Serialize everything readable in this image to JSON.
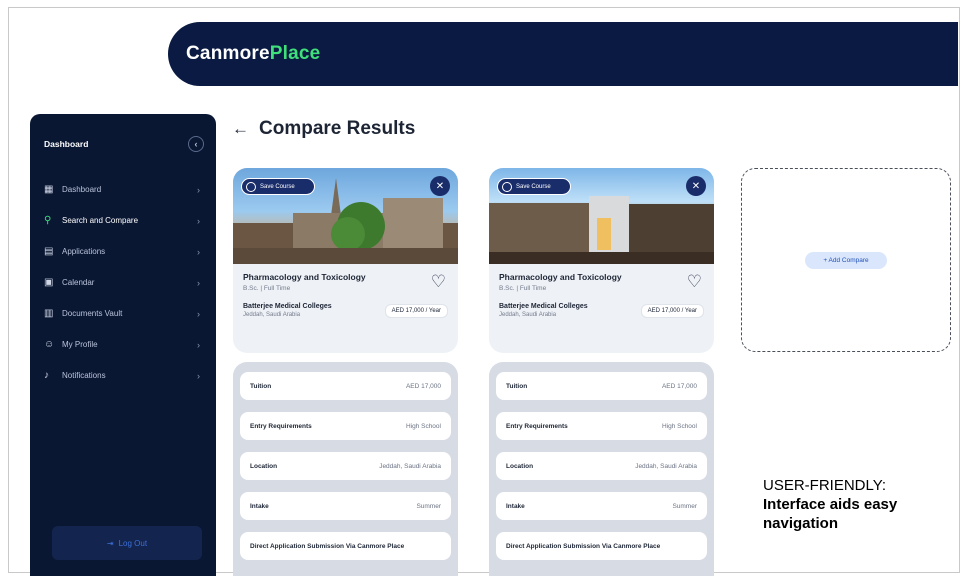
{
  "brand": {
    "logo_part1": "Canmore",
    "logo_part2": "Place"
  },
  "sidebar": {
    "title": "Dashboard",
    "collapse_icon": "chevron-left-icon",
    "items": [
      {
        "label": "Dashboard",
        "icon": "grid-icon"
      },
      {
        "label": "Search and Compare",
        "icon": "search-icon"
      },
      {
        "label": "Applications",
        "icon": "document-icon"
      },
      {
        "label": "Calendar",
        "icon": "calendar-icon"
      },
      {
        "label": "Documents Vault",
        "icon": "folder-icon"
      },
      {
        "label": "My Profile",
        "icon": "user-icon"
      },
      {
        "label": "Notifications",
        "icon": "bell-icon"
      }
    ],
    "logout_label": "Log Out"
  },
  "page": {
    "title": "Compare Results"
  },
  "cards": [
    {
      "tag": "Save Course",
      "program": "Pharmacology and Toxicology",
      "meta": "B.Sc. | Full Time",
      "college": "Batterjee Medical Colleges",
      "location": "Jeddah, Saudi Arabia",
      "fee": "AED 17,000 / Year"
    },
    {
      "tag": "Save Course",
      "program": "Pharmacology and Toxicology",
      "meta": "B.Sc. | Full Time",
      "college": "Batterjee Medical Colleges",
      "location": "Jeddah, Saudi Arabia",
      "fee": "AED 17,000 / Year"
    }
  ],
  "details": [
    {
      "rows": [
        {
          "k": "Tuition",
          "v": "AED 17,000"
        },
        {
          "k": "Entry Requirements",
          "v": "High School"
        },
        {
          "k": "Location",
          "v": "Jeddah, Saudi Arabia"
        },
        {
          "k": "Intake",
          "v": "Summer"
        },
        {
          "k": "Direct Application Submission Via Canmore Place",
          "v": ""
        }
      ]
    },
    {
      "rows": [
        {
          "k": "Tuition",
          "v": "AED 17,000"
        },
        {
          "k": "Entry Requirements",
          "v": "High School"
        },
        {
          "k": "Location",
          "v": "Jeddah, Saudi Arabia"
        },
        {
          "k": "Intake",
          "v": "Summer"
        },
        {
          "k": "Direct Application Submission Via Canmore Place",
          "v": ""
        }
      ]
    }
  ],
  "add_compare_label": "+ Add Compare",
  "caption": {
    "line1": "USER-FRIENDLY:",
    "line2": "Interface aids easy",
    "line3": "navigation"
  }
}
